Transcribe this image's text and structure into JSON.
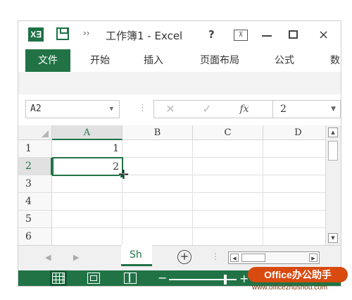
{
  "window": {
    "app_badge": "X∃",
    "qa_more": "››",
    "title": "工作簿1 - Excel",
    "help": "?",
    "ribbon_options": "⊼",
    "close": "×"
  },
  "ribbon": {
    "tabs": [
      {
        "label": "文件",
        "active": true
      },
      {
        "label": "开始"
      },
      {
        "label": "插入"
      },
      {
        "label": "页面布局"
      },
      {
        "label": "公式"
      },
      {
        "label": "数"
      }
    ]
  },
  "formula_bar": {
    "name_box": "A2",
    "dropdown": "▼",
    "dots": "⋮",
    "cancel": "✕",
    "enter": "✓",
    "fx": "fx",
    "content": "2"
  },
  "grid": {
    "columns": [
      "A",
      "B",
      "C",
      "D"
    ],
    "selected_column": "A",
    "rows": [
      {
        "num": "1",
        "cells": [
          "1",
          "",
          "",
          ""
        ]
      },
      {
        "num": "2",
        "cells": [
          "2",
          "",
          "",
          ""
        ]
      },
      {
        "num": "3",
        "cells": [
          "",
          "",
          "",
          ""
        ]
      },
      {
        "num": "4",
        "cells": [
          "",
          "",
          "",
          ""
        ]
      },
      {
        "num": "5",
        "cells": [
          "",
          "",
          "",
          ""
        ]
      },
      {
        "num": "6",
        "cells": [
          "",
          "",
          "",
          ""
        ]
      }
    ],
    "active_cell": "A2",
    "cursor": "✛"
  },
  "sheets": {
    "prev": "◀",
    "next": "▶",
    "active_sheet": "Sh",
    "add": "+",
    "dots": "⋮"
  },
  "scroll": {
    "up": "▲",
    "down": "▼",
    "left": "◀",
    "right": "▶"
  },
  "status": {
    "zoom_minus": "−",
    "zoom_plus": "+",
    "zoom_level": 0.85
  },
  "watermark": {
    "badge": "Office办公助手",
    "url": "www.officezhushou.com"
  },
  "colors": {
    "excel_green": "#217346",
    "watermark_orange": "#d94a0f"
  }
}
